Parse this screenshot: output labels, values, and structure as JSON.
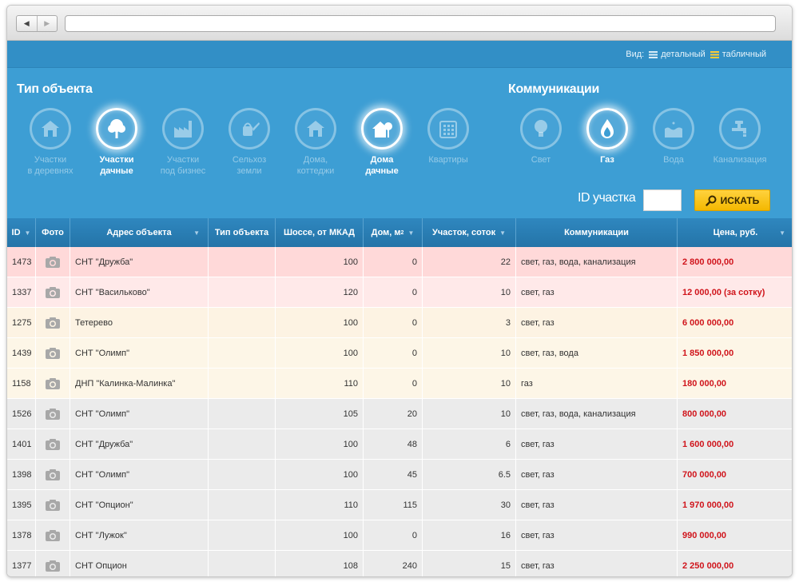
{
  "view": {
    "label": "Вид:",
    "options": [
      {
        "label": "детальный",
        "active": false
      },
      {
        "label": "табличный",
        "active": true
      }
    ]
  },
  "filters": {
    "type_title": "Тип объекта",
    "comm_title": "Коммуникации",
    "types": [
      {
        "label": "Участки\nв деревнях",
        "icon": "house-icon",
        "active": false
      },
      {
        "label": "Участки\nдачные",
        "icon": "tree-icon",
        "active": true
      },
      {
        "label": "Участки\nпод бизнес",
        "icon": "factory-icon",
        "active": false
      },
      {
        "label": "Сельхоз\nземли",
        "icon": "watering-can-icon",
        "active": false
      },
      {
        "label": "Дома,\nкоттеджи",
        "icon": "house-icon",
        "active": false
      },
      {
        "label": "Дома\nдачные",
        "icon": "house-tree-icon",
        "active": true
      },
      {
        "label": "Квартиры",
        "icon": "building-icon",
        "active": false
      }
    ],
    "comms": [
      {
        "label": "Свет",
        "icon": "bulb-icon",
        "active": false
      },
      {
        "label": "Газ",
        "icon": "flame-icon",
        "active": true
      },
      {
        "label": "Вода",
        "icon": "water-icon",
        "active": false
      },
      {
        "label": "Канализация",
        "icon": "faucet-icon",
        "active": false
      }
    ]
  },
  "search": {
    "id_label": "ID участка",
    "id_value": "",
    "button_label": "ИСКАТЬ"
  },
  "table": {
    "headers": [
      "ID",
      "Фото",
      "Адрес объекта",
      "Тип объекта",
      "Шоссе, от МКАД",
      "Дом, м",
      "Участок, соток",
      "Коммуникации",
      "Цена, руб."
    ],
    "header_sup": "2",
    "rows": [
      {
        "id": "1473",
        "address": "СНТ \"Дружба\"",
        "type": "",
        "distance": "100",
        "house": "0",
        "plot": "22",
        "comms": "свет, газ, вода, канализация",
        "price": "2 800 000,00",
        "color": "#ffd9d9"
      },
      {
        "id": "1337",
        "address": "СНТ \"Васильково\"",
        "type": "",
        "distance": "120",
        "house": "0",
        "plot": "10",
        "comms": "свет, газ",
        "price": "12 000,00 (за сотку)",
        "color": "#ffe9e9"
      },
      {
        "id": "1275",
        "address": "Тетерево",
        "type": "",
        "distance": "100",
        "house": "0",
        "plot": "3",
        "comms": "свет, газ",
        "price": "6 000 000,00",
        "color": "#fdf3e3"
      },
      {
        "id": "1439",
        "address": "СНТ \"Олимп\"",
        "type": "",
        "distance": "100",
        "house": "0",
        "plot": "10",
        "comms": "свет, газ, вода",
        "price": "1 850 000,00",
        "color": "#fdf6e7"
      },
      {
        "id": "1158",
        "address": "ДНП \"Калинка-Малинка\"",
        "type": "",
        "distance": "110",
        "house": "0",
        "plot": "10",
        "comms": "газ",
        "price": "180 000,00",
        "color": "#fdf6e7"
      },
      {
        "id": "1526",
        "address": "СНТ \"Олимп\"",
        "type": "",
        "distance": "105",
        "house": "20",
        "plot": "10",
        "comms": "свет, газ, вода, канализация",
        "price": "800 000,00",
        "color": "#ebebeb"
      },
      {
        "id": "1401",
        "address": "СНТ \"Дружба\"",
        "type": "",
        "distance": "100",
        "house": "48",
        "plot": "6",
        "comms": "свет, газ",
        "price": "1 600 000,00",
        "color": "#ebebeb"
      },
      {
        "id": "1398",
        "address": "СНТ \"Олимп\"",
        "type": "",
        "distance": "100",
        "house": "45",
        "plot": "6.5",
        "comms": "свет, газ",
        "price": "700 000,00",
        "color": "#ebebeb"
      },
      {
        "id": "1395",
        "address": "СНТ \"Опцион\"",
        "type": "",
        "distance": "110",
        "house": "115",
        "plot": "30",
        "comms": "свет, газ",
        "price": "1 970 000,00",
        "color": "#ebebeb"
      },
      {
        "id": "1378",
        "address": "СНТ \"Лужок\"",
        "type": "",
        "distance": "100",
        "house": "0",
        "plot": "16",
        "comms": "свет, газ",
        "price": "990 000,00",
        "color": "#ebebeb"
      },
      {
        "id": "1377",
        "address": "СНТ Опцион",
        "type": "",
        "distance": "108",
        "house": "240",
        "plot": "15",
        "comms": "свет, газ",
        "price": "2 250 000,00",
        "color": "#ebebeb"
      }
    ]
  }
}
